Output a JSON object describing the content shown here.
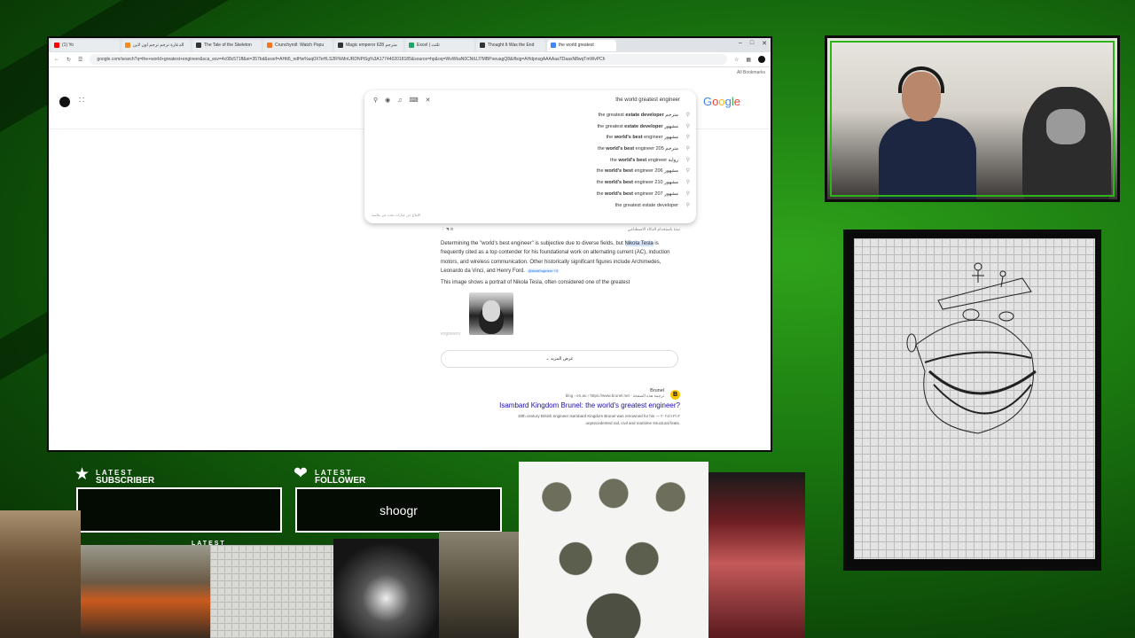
{
  "browser": {
    "tabs": [
      {
        "label": "(1) Yo",
        "color": "#ff0000"
      },
      {
        "label": "الدعارة ترجم ترجم اون لاين",
        "color": "#f28b24"
      },
      {
        "label": "The Tale of the Skeleton",
        "color": "#333333"
      },
      {
        "label": "Crunchyroll: Watch Popu",
        "color": "#f47521"
      },
      {
        "label": "Magic emperor مترجم 628",
        "color": "#333333"
      },
      {
        "label": "Excel | ثلثث",
        "color": "#21a366"
      },
      {
        "label": "Thought It Was the End",
        "color": "#333333"
      },
      {
        "label": "the world greatest",
        "color": "#4285f4"
      }
    ],
    "url": "google.com/search?q=the+world+greatest+engineer&sca_esv=4c08c571ff&ei=357bd&sxsrf=AHtt6_ndHw%uq0XTeHLS2R%MnURDNPiSg%3A1774402018185&source=hp&oq=WvWkaN0CNtUJ7MBPoeuagQ8&iflsig=AHdpnsgAAAAaaTDaaxN8wqTmWvPCh",
    "bookmarks_label": "All Bookmarks"
  },
  "google": {
    "logo": "Google",
    "query": "the world greatest engineer",
    "suggestions": [
      {
        "pre": "مترجم ",
        "text": "the greatest ",
        "bold": "estate developer"
      },
      {
        "pre": "مشهور ",
        "text": "the greatest ",
        "bold": "estate developer"
      },
      {
        "pre": "مشهور ",
        "text": "the ",
        "bold": "world's best",
        "post": " engineer"
      },
      {
        "pre": "مترجم 205 ",
        "text": "the ",
        "bold": "world's best",
        "post": " engineer"
      },
      {
        "pre": "رواية ",
        "text": "the ",
        "bold": "world's best",
        "post": " engineer"
      },
      {
        "pre": "مشهور 206 ",
        "text": "the ",
        "bold": "world's best",
        "post": " engineer"
      },
      {
        "pre": "مشهور 210 ",
        "text": "the ",
        "bold": "world's best",
        "post": " engineer"
      },
      {
        "pre": "مشهور 207 ",
        "text": "the ",
        "bold": "world's best",
        "post": " engineer"
      },
      {
        "pre": "",
        "text": "the greatest estate developer",
        "bold": ""
      }
    ],
    "report_label": "الإبلاغ عن عبارات بحث غير ملائمة",
    "ai_header": "نبذة باستخدام الذكاء الاصطناعي",
    "ai_answer_pre": "Determining the \"world's best engineer\" is subjective due to diverse fields, but ",
    "ai_answer_hl": "Nikola Tesla",
    "ai_answer_post": " is frequently cited as a top contender for his foundational work on alternating current (AC), induction motors, and wireless communication. Other historically significant figures include Archimedes, Leonardo da Vinci, and Henry Ford.",
    "ai_chip": "@bestEngineer +3",
    "ai_image_caption": "This image shows a portrait of Nikola Tesla, often considered one of the greatest",
    "ai_image_tail": "engineers",
    "show_more": "عرض المزيد",
    "result": {
      "site": "Brunel",
      "cite": "blog › en.au › https://www.brunel.net · ترجمة هذه الصفحة",
      "title": "Isambard Kingdom Brunel: the world's greatest engineer?",
      "snippet1": "19th century British engineer Isambard Kingdom Brunel was renowned for his — ٢٠٢٤/١٢/١٢",
      "snippet2": "unprecedented rail, civil and maritime structural feats."
    }
  },
  "widgets": {
    "subscriber": {
      "top": "LATEST",
      "bottom": "SUBSCRIBER",
      "name": ""
    },
    "follower": {
      "top": "LATEST",
      "bottom": "FOLLOWER",
      "name": "shoogr"
    },
    "hidden_label": "LATEST"
  },
  "colors": {
    "overlay_green": "#1b7a10",
    "frame_accent": "#2db51a",
    "link": "#1a0dab"
  }
}
